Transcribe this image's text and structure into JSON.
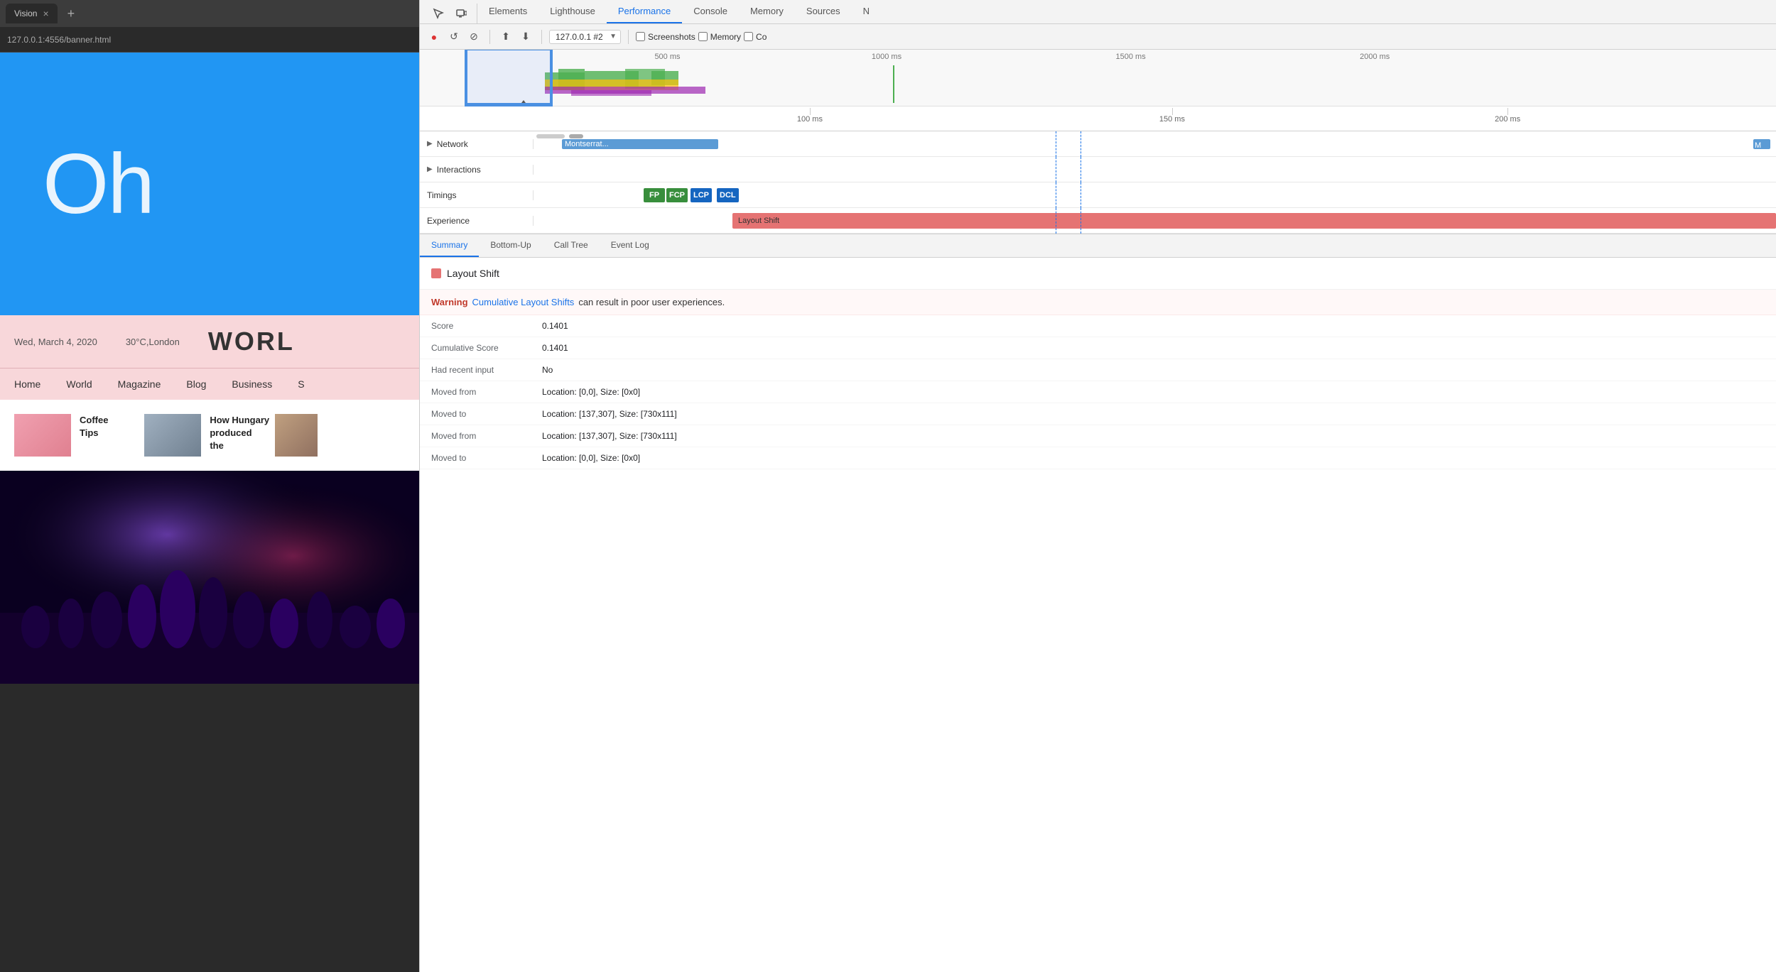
{
  "browser": {
    "tab_title": "Vision",
    "url": "127.0.0.1:4556/banner.html",
    "new_tab_icon": "+",
    "close_icon": "×"
  },
  "page_content": {
    "hero_text": "Oh",
    "date": "Wed, March 4, 2020",
    "location": "30°C,London",
    "news_title": "WORL",
    "nav_items": [
      "Home",
      "World",
      "Magazine",
      "Blog",
      "Business"
    ],
    "articles": [
      {
        "title": "Coffee Tips"
      },
      {
        "title": "How Hungary produced the"
      }
    ]
  },
  "devtools": {
    "tabs": [
      "Elements",
      "Lighthouse",
      "Performance",
      "Console",
      "Memory",
      "Sources",
      "N"
    ],
    "active_tab": "Performance",
    "toolbar": {
      "record_label": "●",
      "reload_label": "↺",
      "clear_label": "⊘",
      "upload_label": "⬆",
      "download_label": "⬇",
      "profile": "127.0.0.1 #2",
      "checkboxes": [
        "Screenshots",
        "Memory",
        "Co"
      ]
    },
    "timeline": {
      "time_marks": [
        "500 ms",
        "1000 ms",
        "1500 ms",
        "2000 ms"
      ],
      "detail_marks": [
        "100 ms",
        "150 ms",
        "200 ms"
      ]
    },
    "rows": {
      "network_label": "Network",
      "network_bar_text": "Montserrat...",
      "network_bar_right_text": "M",
      "interactions_label": "Interactions",
      "timings_label": "Timings",
      "experience_label": "Experience",
      "timing_chips": [
        "FP",
        "FCP",
        "LCP",
        "DCL"
      ],
      "layout_shift_text": "Layout Shift"
    },
    "bottom_panel": {
      "tabs": [
        "Summary",
        "Bottom-Up",
        "Call Tree",
        "Event Log"
      ],
      "active_tab": "Summary",
      "summary": {
        "title": "Layout Shift",
        "warning_label": "Warning",
        "warning_link": "Cumulative Layout Shifts",
        "warning_text": "can result in poor user experiences.",
        "score_label": "Score",
        "score_value": "0.1401",
        "cumulative_score_label": "Cumulative Score",
        "cumulative_score_value": "0.1401",
        "recent_input_label": "Had recent input",
        "recent_input_value": "No",
        "moved_from_1_label": "Moved from",
        "moved_from_1_value": "Location: [0,0], Size: [0x0]",
        "moved_to_1_label": "Moved to",
        "moved_to_1_value": "Location: [137,307], Size: [730x111]",
        "moved_from_2_label": "Moved from",
        "moved_from_2_value": "Location: [137,307], Size: [730x111]",
        "moved_to_2_label": "Moved to",
        "moved_to_2_value": "Location: [0,0], Size: [0x0]"
      }
    }
  },
  "memory_tab_label": "Memory",
  "sidebar_memory_label": "Memory"
}
